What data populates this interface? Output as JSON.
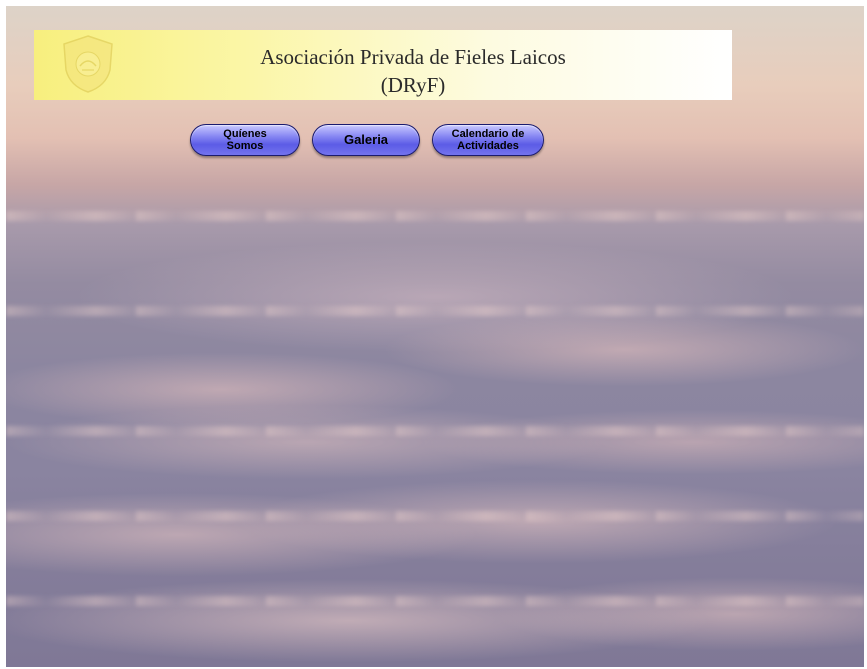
{
  "header": {
    "title_line1": "Asociación Privada de Fieles Laicos",
    "title_line2": "(DRyF)",
    "logo_icon": "association-emblem-icon"
  },
  "nav": {
    "items": [
      {
        "label": "Quíenes Somos",
        "line1": "Quíenes",
        "line2": "Somos"
      },
      {
        "label": "Galeria",
        "line1": "Galeria",
        "line2": ""
      },
      {
        "label": "Calendario de Actividades",
        "line1": "Calendario de",
        "line2": "Actividades"
      }
    ]
  },
  "colors": {
    "header_yellow": "#f7ef7e",
    "button_blue": "#6c6cec",
    "sky_pink": "#e3c0b3",
    "cloud_lavender": "#8c86a0"
  }
}
